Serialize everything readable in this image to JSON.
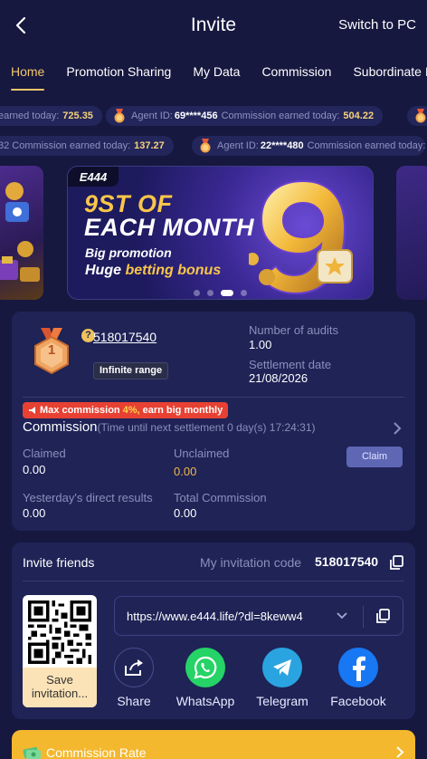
{
  "header": {
    "title": "Invite",
    "switch_label": "Switch to PC"
  },
  "tabs": [
    "Home",
    "Promotion Sharing",
    "My Data",
    "Commission",
    "Subordinate I"
  ],
  "ticker_row1": [
    {
      "agent_id": "",
      "label": "earned today:",
      "value": "725.35"
    },
    {
      "agent_id": "69****456",
      "label": "Commission earned today:",
      "value": "504.22"
    }
  ],
  "ticker_row2": [
    {
      "agent_id": "",
      "label": "32 Commission earned today:",
      "value": "137.27"
    },
    {
      "agent_id": "22****480",
      "label": "Commission earned today:",
      "value": ""
    }
  ],
  "agent_label": "Agent ID:",
  "banner": {
    "brand": "E444",
    "headline1": "9ST OF",
    "headline2": "EACH MONTH",
    "sub1": "Big promotion",
    "sub2_white": "Huge",
    "sub2_gold": "betting bonus",
    "active_dot": 2,
    "dot_count": 4
  },
  "agent": {
    "rank": "1",
    "id": "518017540",
    "range_badge": "Infinite range",
    "audits_label": "Number of audits",
    "audits_value": "1.00",
    "settle_label": "Settlement date",
    "settle_value": "21/08/2026"
  },
  "commission": {
    "max_badge_prefix": "Max commission",
    "max_badge_value": "4%,",
    "max_badge_suffix": "earn big monthly",
    "title": "Commission",
    "countdown": "(Time until next settlement  0 day(s) 17:24:31)",
    "claimed_label": "Claimed",
    "claimed_value": "0.00",
    "unclaimed_label": "Unclaimed",
    "unclaimed_value": "0.00",
    "claim_button": "Claim",
    "yesterday_label": "Yesterday's direct results",
    "yesterday_value": "0.00",
    "total_label": "Total Commission",
    "total_value": "0.00"
  },
  "invite": {
    "title": "Invite friends",
    "code_label": "My invitation code",
    "code_value": "518017540",
    "save_label_1": "Save",
    "save_label_2": "invitation...",
    "link": "https://www.e444.life/?dl=8keww4",
    "share_items": [
      "Share",
      "WhatsApp",
      "Telegram",
      "Facebook"
    ]
  },
  "rate_bar": {
    "label": "Commission Rate"
  },
  "colors": {
    "background": "#16183f",
    "card": "#1f2356",
    "accent_gold": "#f4c66b",
    "badge_red": "#e74133",
    "whatsapp": "#25d366",
    "telegram": "#2aa4e0",
    "facebook": "#1877f2"
  }
}
